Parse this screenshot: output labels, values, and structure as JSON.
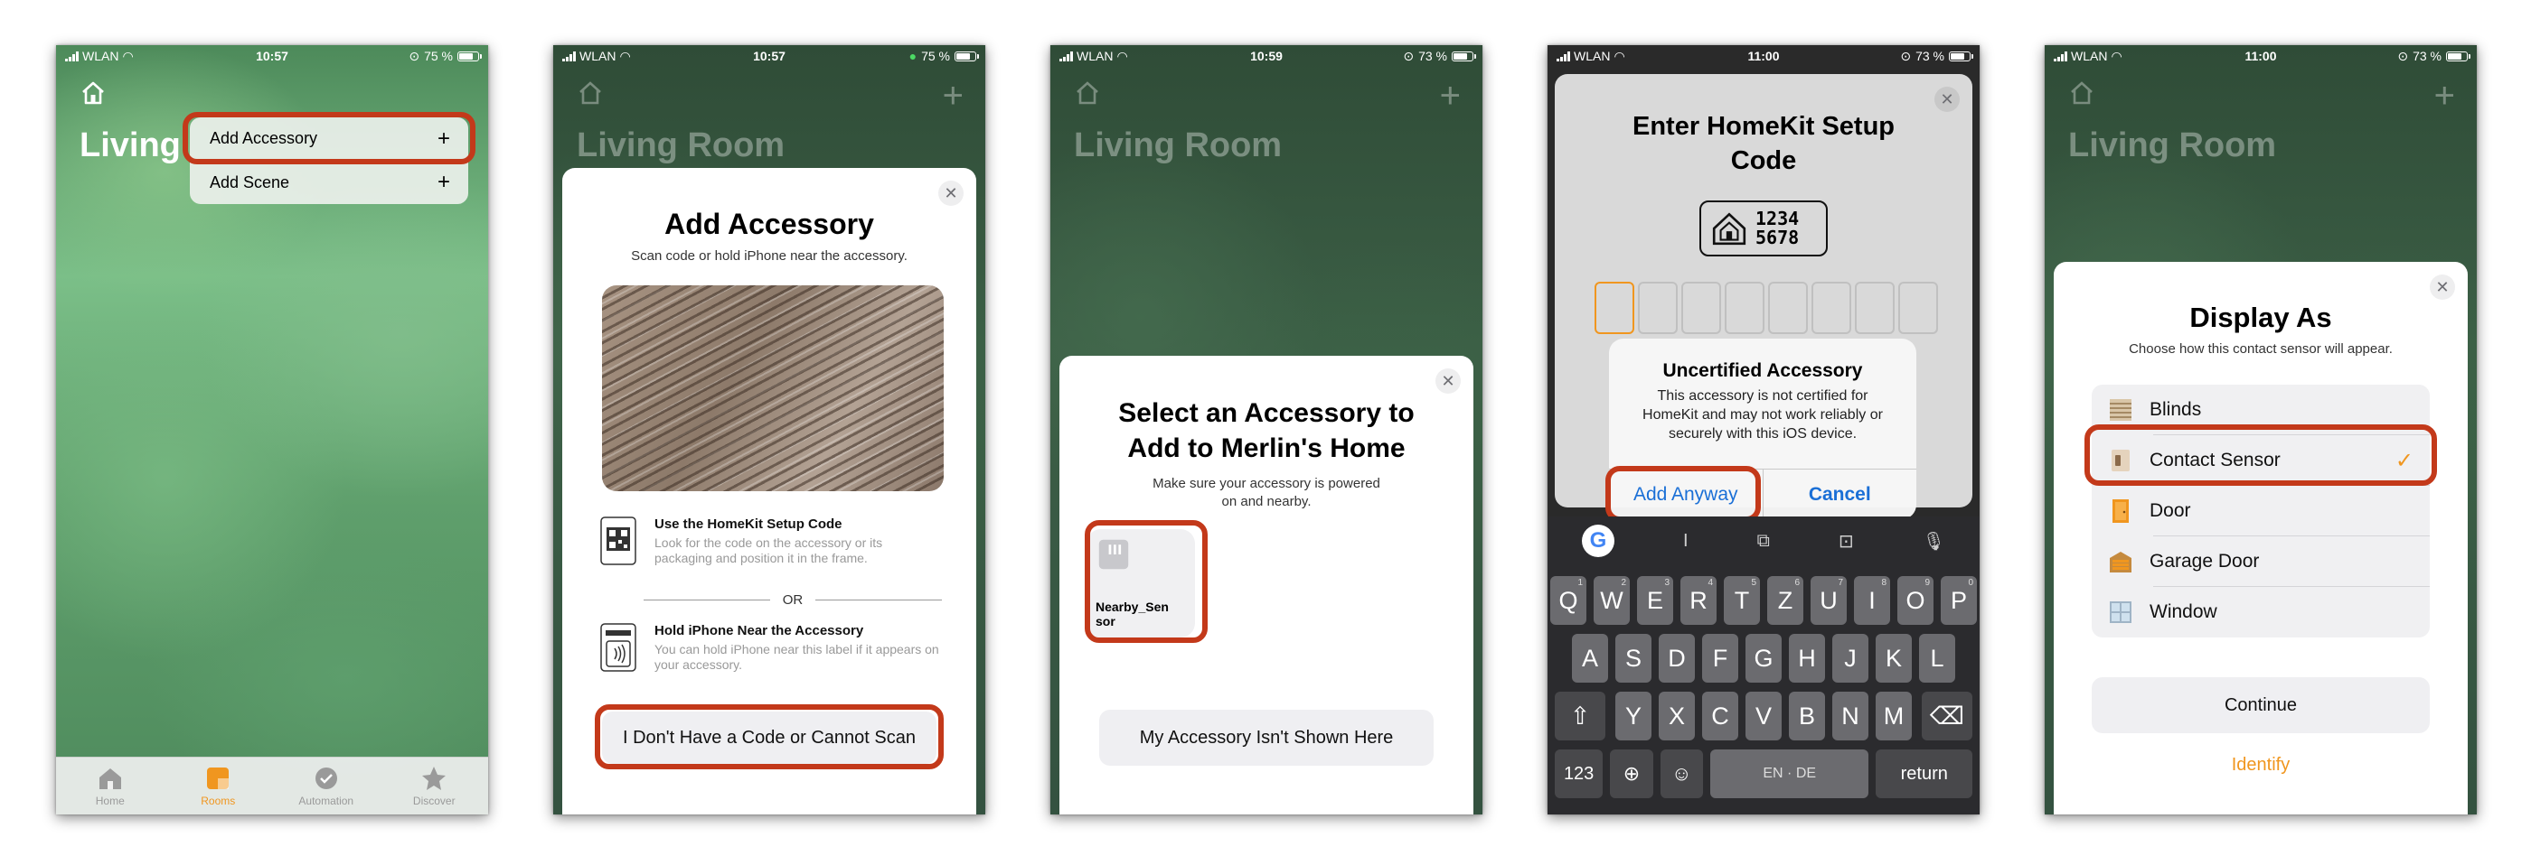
{
  "colors": {
    "accent": "#f0961f",
    "highlight": "#c3391a",
    "ios_blue": "#1a6fd6"
  },
  "screen1": {
    "status": {
      "carrier": "WLAN",
      "time": "10:57",
      "battery": "75 %"
    },
    "title": "Living",
    "menu": [
      {
        "label": "Add Accessory",
        "icon": "plus-icon"
      },
      {
        "label": "Add Scene",
        "icon": "plus-icon"
      }
    ],
    "tabs": [
      {
        "label": "Home",
        "icon": "home-icon"
      },
      {
        "label": "Rooms",
        "icon": "rooms-icon",
        "active": true
      },
      {
        "label": "Automation",
        "icon": "automation-icon"
      },
      {
        "label": "Discover",
        "icon": "star-icon"
      }
    ]
  },
  "screen2": {
    "status": {
      "carrier": "WLAN",
      "time": "10:57",
      "battery": "75 %"
    },
    "room_title": "Living Room",
    "title": "Add Accessory",
    "subtitle": "Scan code or hold iPhone near the accessory.",
    "option1_title": "Use the HomeKit Setup Code",
    "option1_desc": "Look for the code on the accessory or its packaging and position it in the frame.",
    "or_label": "OR",
    "option2_title": "Hold iPhone Near the Accessory",
    "option2_desc": "You can hold iPhone near this label if it appears on your accessory.",
    "button": "I Don't Have a Code or Cannot Scan"
  },
  "screen3": {
    "status": {
      "carrier": "WLAN",
      "time": "10:59",
      "battery": "73 %"
    },
    "room_title": "Living Room",
    "title": "Select an Accessory to Add to Merlin's Home",
    "subtitle": "Make sure your accessory is powered on and nearby.",
    "accessory_name": "Nearby_Sensor",
    "button": "My Accessory Isn't Shown Here"
  },
  "screen4": {
    "status": {
      "carrier": "WLAN",
      "time": "11:00",
      "battery": "73 %"
    },
    "title": "Enter HomeKit Setup Code",
    "code_sample_line1": "1234",
    "code_sample_line2": "5678",
    "alert_title": "Uncertified Accessory",
    "alert_message": "This accessory is not certified for HomeKit and may not work reliably or securely with this iOS device.",
    "alert_primary": "Add Anyway",
    "alert_cancel": "Cancel",
    "keyboard_rows": [
      [
        {
          "k": "Q",
          "n": "1"
        },
        {
          "k": "W",
          "n": "2"
        },
        {
          "k": "E",
          "n": "3"
        },
        {
          "k": "R",
          "n": "4"
        },
        {
          "k": "T",
          "n": "5"
        },
        {
          "k": "Z",
          "n": "6"
        },
        {
          "k": "U",
          "n": "7"
        },
        {
          "k": "I",
          "n": "8"
        },
        {
          "k": "O",
          "n": "9"
        },
        {
          "k": "P",
          "n": "0"
        }
      ],
      [
        {
          "k": "A"
        },
        {
          "k": "S"
        },
        {
          "k": "D"
        },
        {
          "k": "F"
        },
        {
          "k": "G"
        },
        {
          "k": "H"
        },
        {
          "k": "J"
        },
        {
          "k": "K"
        },
        {
          "k": "L"
        }
      ],
      [
        {
          "k": "Y"
        },
        {
          "k": "X"
        },
        {
          "k": "C"
        },
        {
          "k": "V"
        },
        {
          "k": "B"
        },
        {
          "k": "N"
        },
        {
          "k": "M"
        }
      ]
    ],
    "key_numbers": "123",
    "key_space": "EN · DE",
    "key_return": "return"
  },
  "screen5": {
    "status": {
      "carrier": "WLAN",
      "time": "11:00",
      "battery": "73 %"
    },
    "room_title": "Living Room",
    "title": "Display As",
    "subtitle": "Choose how this contact sensor will appear.",
    "options": [
      {
        "label": "Blinds",
        "icon": "blinds-icon",
        "selected": false
      },
      {
        "label": "Contact Sensor",
        "icon": "contact-sensor-icon",
        "selected": true
      },
      {
        "label": "Door",
        "icon": "door-icon",
        "selected": false
      },
      {
        "label": "Garage Door",
        "icon": "garage-door-icon",
        "selected": false
      },
      {
        "label": "Window",
        "icon": "window-icon",
        "selected": false
      }
    ],
    "button": "Continue",
    "link": "Identify"
  }
}
